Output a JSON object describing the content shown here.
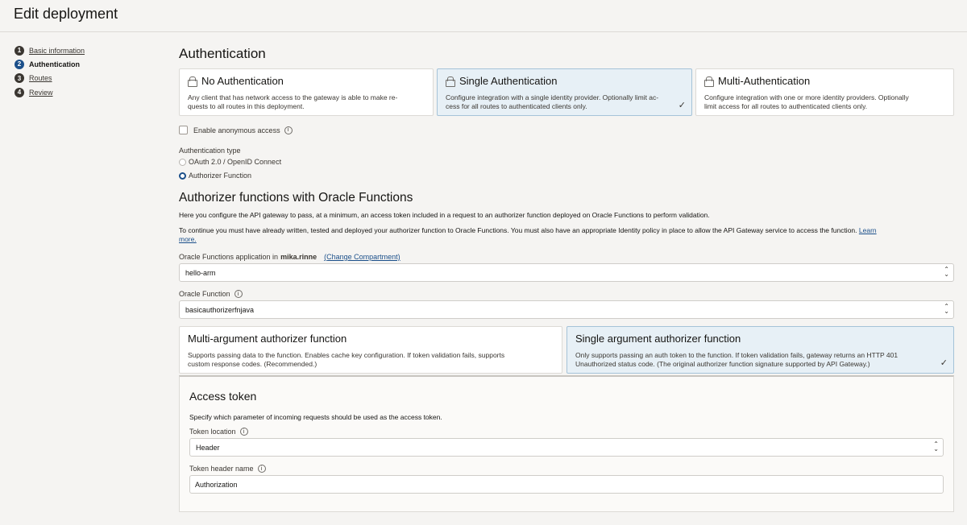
{
  "page": {
    "title": "Edit deployment"
  },
  "steps": [
    {
      "num": "1",
      "label": "Basic information"
    },
    {
      "num": "2",
      "label": "Authentication"
    },
    {
      "num": "3",
      "label": "Routes"
    },
    {
      "num": "4",
      "label": "Review"
    }
  ],
  "auth": {
    "title": "Authentication",
    "cards": [
      {
        "title": "No Authentication",
        "desc1": "Any client that has network access to the gateway is able to make re-",
        "desc2": "quests to all routes in this deployment."
      },
      {
        "title": "Single Authentication",
        "desc1": "Configure integration with a single identity provider. Optionally limit ac-",
        "desc2": "cess for all routes to authenticated clients only."
      },
      {
        "title": "Multi-Authentication",
        "desc1": "Configure integration with one or more identity providers. Optionally",
        "desc2": "limit access for all routes to authenticated clients only."
      }
    ],
    "anonymous_label": "Enable anonymous access",
    "type_label": "Authentication type",
    "type_options": [
      "OAuth 2.0 / OpenID Connect",
      "Authorizer Function"
    ]
  },
  "authorizer": {
    "title": "Authorizer functions with Oracle Functions",
    "para1": "Here you configure the API gateway to pass, at a minimum, an access token included in a request to an authorizer function deployed on Oracle Functions to perform validation.",
    "para2": "To continue you must have already written, tested and deployed your authorizer function to Oracle Functions. You must also have an appropriate Identity policy in place to allow the API Gateway service to access the function.",
    "learn_more_1": "Learn",
    "learn_more_2": "more.",
    "app_label_prefix": "Oracle Functions application in",
    "compartment": "mika.rinne",
    "change_compartment": "(Change Compartment)",
    "app_value": "hello-arm",
    "function_label": "Oracle Function",
    "function_value": "basicauthorizerfnjava",
    "cards": [
      {
        "title": "Multi-argument authorizer function",
        "desc1": "Supports passing data to the function. Enables cache key configuration. If token validation fails, supports",
        "desc2": "custom response codes. (Recommended.)"
      },
      {
        "title": "Single argument authorizer function",
        "desc1": "Only supports passing an auth token to the function. If token validation fails, gateway returns an HTTP 401",
        "desc2": "Unauthorized status code. (The original authorizer function signature supported by API Gateway.)"
      }
    ]
  },
  "token": {
    "title": "Access token",
    "desc": "Specify which parameter of incoming requests should be used as the access token.",
    "location_label": "Token location",
    "location_value": "Header",
    "header_label": "Token header name",
    "header_value": "Authorization"
  },
  "icons": {
    "info": "info-icon",
    "lock": "lock-icon",
    "check": "checkmark-icon",
    "select": "select-arrows-icon"
  },
  "colors": {
    "selected_card": "#e7f0f6",
    "accent": "#1b4f8a"
  }
}
